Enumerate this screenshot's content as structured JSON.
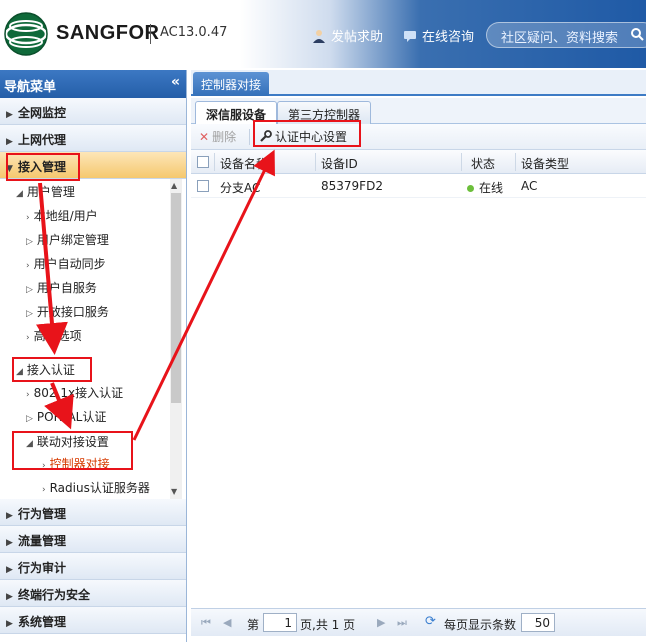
{
  "header": {
    "brand": "SANGFOR",
    "version": "AC13.0.47",
    "help_link": "发帖求助",
    "consult_link": "在线咨询",
    "search_placeholder": "社区疑问、资料搜索"
  },
  "sidebar": {
    "title": "导航菜单",
    "collapse": "«",
    "categories_top": [
      {
        "label": "全网监控"
      },
      {
        "label": "上网代理"
      },
      {
        "label": "接入管理"
      }
    ],
    "tree": {
      "user_mgmt": "用户管理",
      "local_users": "本地组/用户",
      "user_binding": "用户绑定管理",
      "user_sync": "用户自动同步",
      "user_self": "用户自服务",
      "open_api": "开放接口服务",
      "advanced": "高级选项",
      "access_auth": "接入认证",
      "dot1x": "802.1x接入认证",
      "portal": "PORTAL认证",
      "linkage": "联动对接设置",
      "controller": "控制器对接",
      "radius": "Radius认证服务器"
    },
    "categories_bottom": [
      {
        "label": "行为管理"
      },
      {
        "label": "流量管理"
      },
      {
        "label": "行为审计"
      },
      {
        "label": "终端行为安全"
      },
      {
        "label": "系统管理"
      }
    ]
  },
  "main": {
    "page_tab": "控制器对接",
    "sub_tabs": [
      "深信服设备",
      "第三方控制器"
    ],
    "toolbar": {
      "delete": "删除",
      "auth_center": "认证中心设置"
    },
    "columns": [
      "设备名称",
      "设备ID",
      "状态",
      "设备类型"
    ],
    "rows": [
      {
        "name": "分支AC",
        "id": "85379FD2",
        "status": "在线",
        "type": "AC"
      }
    ],
    "pager": {
      "page_prefix": "第",
      "page_value": "1",
      "page_suffix": "页,共 1 页",
      "per_page_label": "每页显示条数",
      "per_page_value": "50"
    }
  },
  "colors": {
    "accent": "#245ea8",
    "annotation": "#e8131a",
    "active_category": "#f5c86e",
    "online": "#6cbf3b"
  }
}
